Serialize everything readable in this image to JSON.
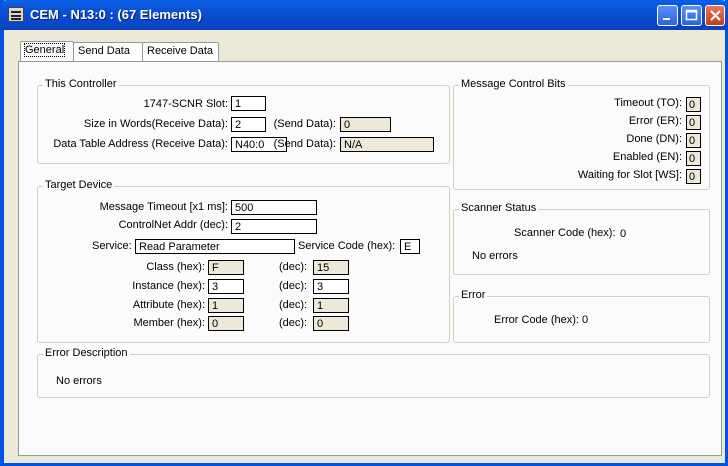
{
  "window": {
    "title": "CEM - N13:0 : (67 Elements)"
  },
  "tabs": [
    "General",
    "Send Data",
    "Receive Data"
  ],
  "this_controller": {
    "title": "This Controller",
    "slot_label": "1747-SCNR Slot:",
    "slot_value": "1",
    "size_label": "Size in Words(Receive Data):",
    "size_value": "2",
    "size_send_label": "(Send Data):",
    "size_send_value": "0",
    "addr_label": "Data Table Address (Receive Data):",
    "addr_value": "N40:0",
    "addr_send_label": "(Send Data):",
    "addr_send_value": "N/A"
  },
  "target_device": {
    "title": "Target Device",
    "timeout_label": "Message Timeout [x1 ms]:",
    "timeout_value": "500",
    "controlnet_label": "ControlNet Addr (dec):",
    "controlnet_value": "2",
    "service_label": "Service:",
    "service_value": "Read Parameter",
    "service_code_label": "Service Code (hex):",
    "service_code_value": "E",
    "dec_label": "(dec):",
    "class_label": "Class (hex):",
    "class_hex": "F",
    "class_dec": "15",
    "instance_label": "Instance (hex):",
    "instance_hex": "3",
    "instance_dec": "3",
    "attribute_label": "Attribute (hex):",
    "attribute_hex": "1",
    "attribute_dec": "1",
    "member_label": "Member (hex):",
    "member_hex": "0",
    "member_dec": "0"
  },
  "message_control_bits": {
    "title": "Message Control Bits",
    "bits": [
      {
        "label": "Timeout (TO):",
        "value": "0"
      },
      {
        "label": "Error (ER):",
        "value": "0"
      },
      {
        "label": "Done (DN):",
        "value": "0"
      },
      {
        "label": "Enabled (EN):",
        "value": "0"
      },
      {
        "label": "Waiting for Slot [WS]:",
        "value": "0"
      }
    ]
  },
  "scanner_status": {
    "title": "Scanner Status",
    "code_label": "Scanner Code (hex):",
    "code_value": "0",
    "message": "No errors"
  },
  "error": {
    "title": "Error",
    "code_label": "Error Code (hex):",
    "code_value": "0"
  },
  "error_description": {
    "title": "Error Description",
    "text": "No errors"
  },
  "colors": {
    "titlebar": "#0a4fd4",
    "dialog_bg": "#ece9d8",
    "close_button": "#c33c1d"
  }
}
